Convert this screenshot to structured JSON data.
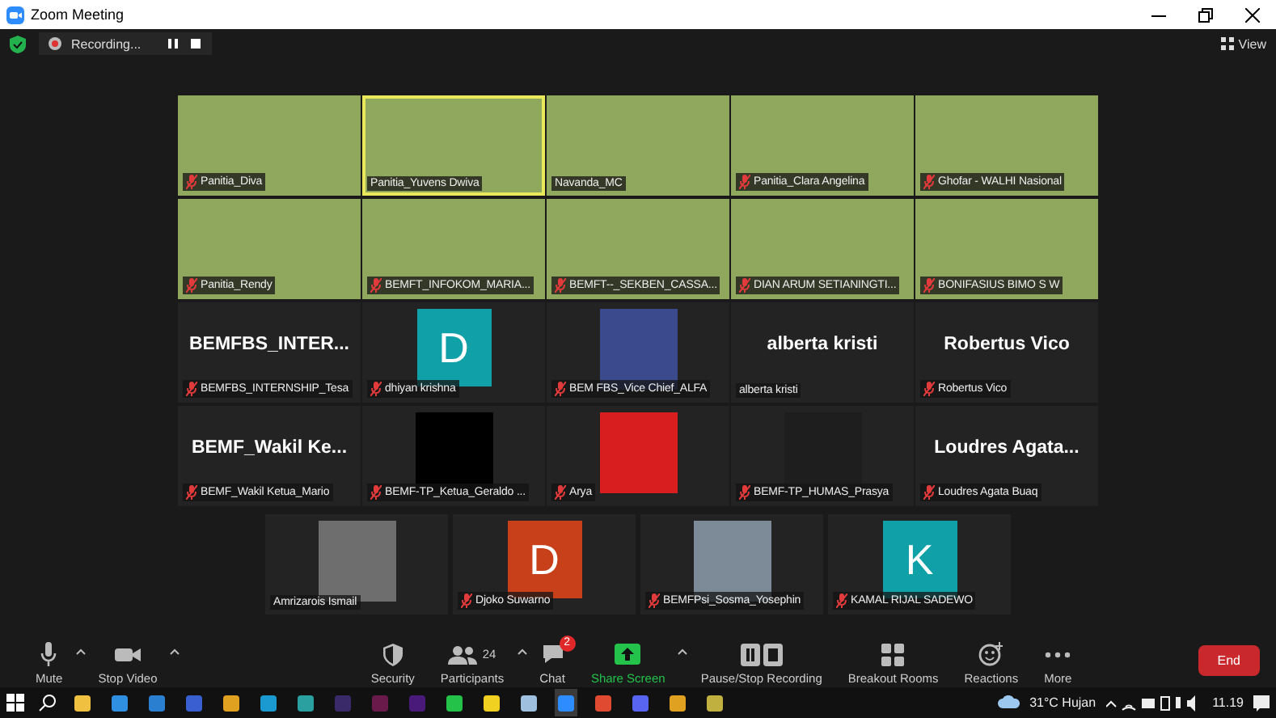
{
  "window": {
    "title": "Zoom Meeting"
  },
  "top_bar": {
    "recording_label": "Recording...",
    "view_label": "View"
  },
  "gallery": {
    "rows": [
      {
        "tiles": [
          {
            "kind": "video",
            "label": "Panitia_Diva",
            "muted": true,
            "speaking": false
          },
          {
            "kind": "video",
            "label": "Panitia_Yuvens Dwiva",
            "muted": false,
            "speaking": true
          },
          {
            "kind": "video",
            "label": "Navanda_MC",
            "muted": false,
            "speaking": false
          },
          {
            "kind": "video",
            "label": "Panitia_Clara Angelina",
            "muted": true,
            "speaking": false
          },
          {
            "kind": "video",
            "label": "Ghofar - WALHI Nasional",
            "muted": true,
            "speaking": false
          }
        ]
      },
      {
        "tiles": [
          {
            "kind": "video",
            "label": "Panitia_Rendy",
            "muted": true,
            "speaking": false
          },
          {
            "kind": "video",
            "label": "BEMFT_INFOKOM_MARIA...",
            "muted": true,
            "speaking": false
          },
          {
            "kind": "video",
            "label": "BEMFT--_SEKBEN_CASSA...",
            "muted": true,
            "speaking": false
          },
          {
            "kind": "video",
            "label": "DIAN ARUM SETIANINGTI...",
            "muted": true,
            "speaking": false
          },
          {
            "kind": "video",
            "label": "BONIFASIUS BIMO S W",
            "muted": true,
            "speaking": false
          }
        ]
      },
      {
        "tiles": [
          {
            "kind": "name",
            "display_name": "BEMFBS_INTER...",
            "label": "BEMFBS_INTERNSHIP_Tesa",
            "muted": true,
            "speaking": false
          },
          {
            "kind": "avatar",
            "initial": "D",
            "color": "#10a0a8",
            "label": "dhiyan krishna",
            "muted": true,
            "speaking": false
          },
          {
            "kind": "photo",
            "color": "#3a4a8c",
            "label": "BEM FBS_Vice Chief_ALFA",
            "muted": true,
            "speaking": false
          },
          {
            "kind": "name",
            "display_name": "alberta kristi",
            "label": "alberta kristi",
            "muted": false,
            "speaking": false
          },
          {
            "kind": "name",
            "display_name": "Robertus Vico",
            "label": "Robertus Vico",
            "muted": true,
            "speaking": false
          }
        ]
      },
      {
        "tiles": [
          {
            "kind": "name",
            "display_name": "BEMF_Wakil  Ke...",
            "label": "BEMF_Wakil Ketua_Mario",
            "muted": true,
            "speaking": false
          },
          {
            "kind": "photo",
            "color": "#000000",
            "label": "BEMF-TP_Ketua_Geraldo ...",
            "muted": true,
            "speaking": false
          },
          {
            "kind": "photo",
            "color": "#d81e1e",
            "label": "Arya",
            "muted": true,
            "speaking": false
          },
          {
            "kind": "photo",
            "color": "#1e1e1e",
            "label": "BEMF-TP_HUMAS_Prasya",
            "muted": true,
            "speaking": false
          },
          {
            "kind": "name",
            "display_name": "Loudres  Agata...",
            "label": "Loudres Agata Buaq",
            "muted": true,
            "speaking": false
          }
        ]
      },
      {
        "tiles": [
          {
            "kind": "photo",
            "color": "#6e6e6e",
            "label": "Amrizarois Ismail",
            "muted": false,
            "speaking": false
          },
          {
            "kind": "avatar",
            "initial": "D",
            "color": "#c8401a",
            "label": "Djoko Suwarno",
            "muted": true,
            "speaking": false
          },
          {
            "kind": "photo",
            "color": "#7d8a98",
            "label": "BEMFPsi_Sosma_Yosephin",
            "muted": true,
            "speaking": false
          },
          {
            "kind": "avatar",
            "initial": "K",
            "color": "#10a0a8",
            "label": "KAMAL RIJAL SADEWO",
            "muted": true,
            "speaking": false
          }
        ]
      }
    ]
  },
  "toolbar": {
    "left": [
      {
        "kind": "mic",
        "label": "Mute",
        "caret": true
      },
      {
        "kind": "camera",
        "label": "Stop Video",
        "caret": true
      }
    ],
    "center": [
      {
        "kind": "security",
        "label": "Security",
        "caret": false
      },
      {
        "kind": "participants",
        "label": "Participants",
        "count": "24",
        "caret": true
      },
      {
        "kind": "chat",
        "label": "Chat",
        "badge": "2",
        "caret": false
      },
      {
        "kind": "share",
        "label": "Share Screen",
        "caret": true
      },
      {
        "kind": "recording",
        "label": "Pause/Stop Recording",
        "caret": false
      },
      {
        "kind": "breakout",
        "label": "Breakout Rooms",
        "caret": false
      },
      {
        "kind": "reactions",
        "label": "Reactions",
        "caret": false
      },
      {
        "kind": "more",
        "label": "More",
        "caret": false
      }
    ],
    "end_button": "End"
  },
  "taskbar": {
    "weather": "31°C Hujan",
    "time": "11.19"
  }
}
